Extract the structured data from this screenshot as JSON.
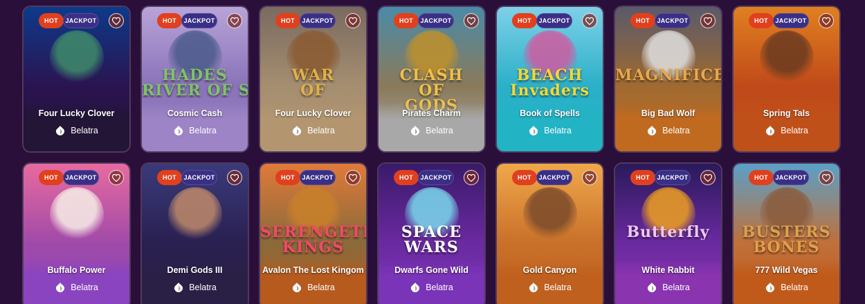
{
  "colors": {
    "page_bg": "#2a0f3a",
    "hot_badge": "#e0401e",
    "jackpot_badge": "#3a2f86"
  },
  "labels": {
    "hot": "HOT",
    "jackpot": "JACKPOT"
  },
  "games": [
    {
      "name": "Four Lucky Clover",
      "provider": "Belatra",
      "art": "",
      "bg": [
        "#0d3a8a",
        "#2a1450",
        "#221536"
      ],
      "figure": "#3f8c6a",
      "title_color": "#d8c38a"
    },
    {
      "name": "Cosmic Cash",
      "provider": "Belatra",
      "art": "HADES\nRIVER OF SOULS",
      "bg": [
        "#b8a4d8",
        "#8a72b8",
        "#9c84c6"
      ],
      "figure": "#4a5a8a",
      "title_color": "#7ec26a"
    },
    {
      "name": "Four Lucky Clover",
      "provider": "Belatra",
      "art": "WAR\nOF",
      "bg": [
        "#7a6a60",
        "#a58e70",
        "#b39670"
      ],
      "figure": "#8a5a30",
      "title_color": "#e0b04a"
    },
    {
      "name": "Pirates Charm",
      "provider": "Belatra",
      "art": "CLASH\nOF\nGODS",
      "bg": [
        "#4a8aa8",
        "#8a7a5a",
        "#a8a8a8"
      ],
      "figure": "#c0902a",
      "title_color": "#f0c04a"
    },
    {
      "name": "Book of Spells",
      "provider": "Belatra",
      "art": "BEACH\nInvaders",
      "bg": [
        "#7ed0e8",
        "#2ab0c8",
        "#22b3c4"
      ],
      "figure": "#d05aa0",
      "title_color": "#f2d83a"
    },
    {
      "name": "Big Bad Wolf",
      "provider": "Belatra",
      "art": "MAGNIFICENT",
      "bg": [
        "#5a5a6a",
        "#a06a30",
        "#c06a20"
      ],
      "figure": "#e0e0e0",
      "title_color": "#e8a84a"
    },
    {
      "name": "Spring Tals",
      "provider": "Belatra",
      "art": "",
      "bg": [
        "#e08020",
        "#c04a1a",
        "#c0501a"
      ],
      "figure": "#6a3a20",
      "title_color": "#f0d04a"
    },
    {
      "name": "Buffalo Power",
      "provider": "Belatra",
      "art": "",
      "bg": [
        "#e86aa0",
        "#a04aa8",
        "#8a44c0"
      ],
      "figure": "#f8f0e8",
      "title_color": "#ffffff"
    },
    {
      "name": "Demi Gods III",
      "provider": "Belatra",
      "art": "",
      "bg": [
        "#3a3a7a",
        "#2a2050",
        "#2a2046"
      ],
      "figure": "#c08a6a",
      "title_color": "#ffffff"
    },
    {
      "name": "Avalon The Lost Kingom",
      "provider": "Belatra",
      "art": "SERENGETI\nKINGS",
      "bg": [
        "#e07a3a",
        "#8a6a3a",
        "#b65a1e"
      ],
      "figure": "#c8802a",
      "title_color": "#f04a6a"
    },
    {
      "name": "Dwarfs Gone Wild",
      "provider": "Belatra",
      "art": "SPACE\nWARS",
      "bg": [
        "#3a1a6a",
        "#6a2aa0",
        "#7a34b8"
      ],
      "figure": "#7adaf0",
      "title_color": "#ffffff"
    },
    {
      "name": "Gold Canyon",
      "provider": "Belatra",
      "art": "",
      "bg": [
        "#f0a84a",
        "#c8702a",
        "#c0601e"
      ],
      "figure": "#7a4a2a",
      "title_color": "#ffffff"
    },
    {
      "name": "White Rabbit",
      "provider": "Belatra",
      "art": "Butterfly",
      "bg": [
        "#2a1a5a",
        "#6a2aa0",
        "#8a34b0"
      ],
      "figure": "#f0a020",
      "title_color": "#f0c8f8"
    },
    {
      "name": "777 Wild Vegas",
      "provider": "Belatra",
      "art": "BUSTERS\nBONES",
      "bg": [
        "#5aa0c8",
        "#c0703a",
        "#c05a1a"
      ],
      "figure": "#8a5a3a",
      "title_color": "#e0a04a"
    }
  ]
}
